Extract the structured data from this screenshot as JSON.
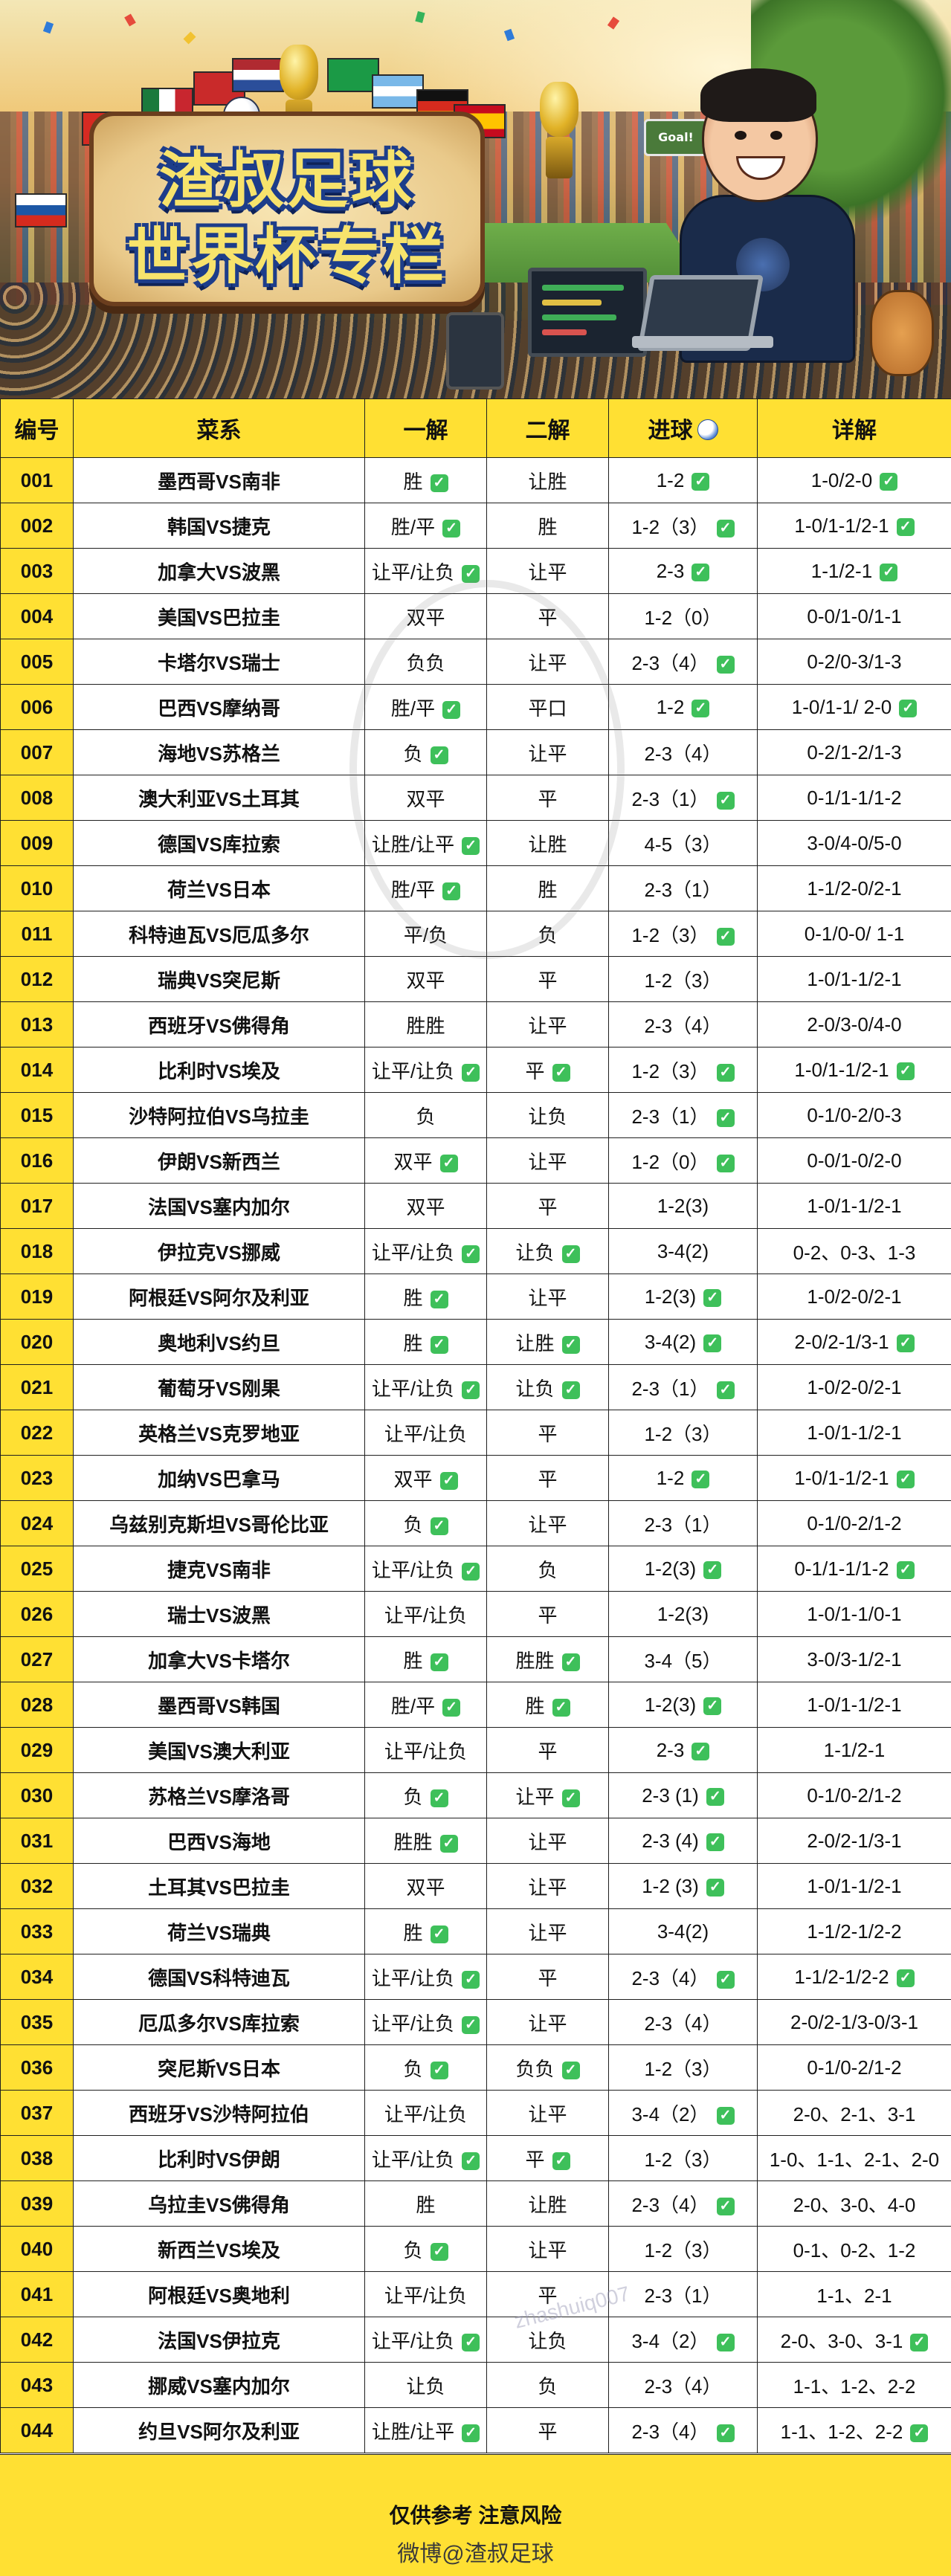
{
  "hero": {
    "title_line1": "渣叔足球",
    "title_line2": "世界杯专栏",
    "goal_sign": "Goal!"
  },
  "table": {
    "headers": [
      "编号",
      "菜系",
      "一解",
      "二解",
      "进球",
      "详解"
    ],
    "rows": [
      {
        "id": "001",
        "match": "墨西哥VS南非",
        "p1": "胜",
        "p1_ok": true,
        "p2": "让胜",
        "p2_ok": false,
        "goals": "1-2",
        "goals_ok": true,
        "detail": "1-0/2-0",
        "detail_ok": true
      },
      {
        "id": "002",
        "match": "韩国VS捷克",
        "p1": "胜/平",
        "p1_ok": true,
        "p2": "胜",
        "p2_ok": false,
        "goals": "1-2（3）",
        "goals_ok": true,
        "detail": "1-0/1-1/2-1",
        "detail_ok": true
      },
      {
        "id": "003",
        "match": "加拿大VS波黑",
        "p1": "让平/让负",
        "p1_ok": true,
        "p2": "让平",
        "p2_ok": false,
        "goals": "2-3",
        "goals_ok": true,
        "detail": "1-1/2-1",
        "detail_ok": true
      },
      {
        "id": "004",
        "match": "美国VS巴拉圭",
        "p1": "双平",
        "p1_ok": false,
        "p2": "平",
        "p2_ok": false,
        "goals": "1-2（0）",
        "goals_ok": false,
        "detail": "0-0/1-0/1-1",
        "detail_ok": false
      },
      {
        "id": "005",
        "match": "卡塔尔VS瑞士",
        "p1": "负负",
        "p1_ok": false,
        "p2": "让平",
        "p2_ok": false,
        "goals": "2-3（4）",
        "goals_ok": true,
        "detail": "0-2/0-3/1-3",
        "detail_ok": false
      },
      {
        "id": "006",
        "match": "巴西VS摩纳哥",
        "p1": "胜/平",
        "p1_ok": true,
        "p2": "平口",
        "p2_ok": false,
        "goals": "1-2",
        "goals_ok": true,
        "detail": "1-0/1-1/ 2-0",
        "detail_ok": true
      },
      {
        "id": "007",
        "match": "海地VS苏格兰",
        "p1": "负",
        "p1_ok": true,
        "p2": "让平",
        "p2_ok": false,
        "goals": "2-3（4）",
        "goals_ok": false,
        "detail": "0-2/1-2/1-3",
        "detail_ok": false
      },
      {
        "id": "008",
        "match": "澳大利亚VS土耳其",
        "p1": "双平",
        "p1_ok": false,
        "p2": "平",
        "p2_ok": false,
        "goals": "2-3（1）",
        "goals_ok": true,
        "detail": "0-1/1-1/1-2",
        "detail_ok": false
      },
      {
        "id": "009",
        "match": "德国VS库拉索",
        "p1": "让胜/让平",
        "p1_ok": true,
        "p2": "让胜",
        "p2_ok": false,
        "goals": "4-5（3）",
        "goals_ok": false,
        "detail": "3-0/4-0/5-0",
        "detail_ok": false
      },
      {
        "id": "010",
        "match": "荷兰VS日本",
        "p1": "胜/平",
        "p1_ok": true,
        "p2": "胜",
        "p2_ok": false,
        "goals": "2-3（1）",
        "goals_ok": false,
        "detail": "1-1/2-0/2-1",
        "detail_ok": false
      },
      {
        "id": "011",
        "match": "科特迪瓦VS厄瓜多尔",
        "p1": "平/负",
        "p1_ok": false,
        "p2": "负",
        "p2_ok": false,
        "goals": "1-2（3）",
        "goals_ok": true,
        "detail": "0-1/0-0/ 1-1",
        "detail_ok": false
      },
      {
        "id": "012",
        "match": "瑞典VS突尼斯",
        "p1": "双平",
        "p1_ok": false,
        "p2": "平",
        "p2_ok": false,
        "goals": "1-2（3）",
        "goals_ok": false,
        "detail": "1-0/1-1/2-1",
        "detail_ok": false
      },
      {
        "id": "013",
        "match": "西班牙VS佛得角",
        "p1": "胜胜",
        "p1_ok": false,
        "p2": "让平",
        "p2_ok": false,
        "goals": "2-3（4）",
        "goals_ok": false,
        "detail": "2-0/3-0/4-0",
        "detail_ok": false
      },
      {
        "id": "014",
        "match": "比利时VS埃及",
        "p1": "让平/让负",
        "p1_ok": true,
        "p2": "平",
        "p2_ok": true,
        "goals": "1-2（3）",
        "goals_ok": true,
        "detail": "1-0/1-1/2-1",
        "detail_ok": true
      },
      {
        "id": "015",
        "match": "沙特阿拉伯VS乌拉圭",
        "p1": "负",
        "p1_ok": false,
        "p2": "让负",
        "p2_ok": false,
        "goals": "2-3（1）",
        "goals_ok": true,
        "detail": "0-1/0-2/0-3",
        "detail_ok": false
      },
      {
        "id": "016",
        "match": "伊朗VS新西兰",
        "p1": "双平",
        "p1_ok": true,
        "p2": "让平",
        "p2_ok": false,
        "goals": "1-2（0）",
        "goals_ok": true,
        "detail": "0-0/1-0/2-0",
        "detail_ok": false
      },
      {
        "id": "017",
        "match": "法国VS塞内加尔",
        "p1": "双平",
        "p1_ok": false,
        "p2": "平",
        "p2_ok": false,
        "goals": "1-2(3)",
        "goals_ok": false,
        "detail": "1-0/1-1/2-1",
        "detail_ok": false
      },
      {
        "id": "018",
        "match": "伊拉克VS挪威",
        "p1": "让平/让负",
        "p1_ok": true,
        "p2": "让负",
        "p2_ok": true,
        "goals": "3-4(2)",
        "goals_ok": false,
        "detail": "0-2、0-3、1-3",
        "detail_ok": false
      },
      {
        "id": "019",
        "match": "阿根廷VS阿尔及利亚",
        "p1": "胜",
        "p1_ok": true,
        "p2": "让平",
        "p2_ok": false,
        "goals": "1-2(3)",
        "goals_ok": true,
        "detail": "1-0/2-0/2-1",
        "detail_ok": false
      },
      {
        "id": "020",
        "match": "奥地利VS约旦",
        "p1": "胜",
        "p1_ok": true,
        "p2": "让胜",
        "p2_ok": true,
        "goals": "3-4(2)",
        "goals_ok": true,
        "detail": "2-0/2-1/3-1",
        "detail_ok": true
      },
      {
        "id": "021",
        "match": "葡萄牙VS刚果",
        "p1": "让平/让负",
        "p1_ok": true,
        "p2": "让负",
        "p2_ok": true,
        "goals": "2-3（1）",
        "goals_ok": true,
        "detail": "1-0/2-0/2-1",
        "detail_ok": false
      },
      {
        "id": "022",
        "match": "英格兰VS克罗地亚",
        "p1": "让平/让负",
        "p1_ok": false,
        "p2": "平",
        "p2_ok": false,
        "goals": "1-2（3）",
        "goals_ok": false,
        "detail": "1-0/1-1/2-1",
        "detail_ok": false
      },
      {
        "id": "023",
        "match": "加纳VS巴拿马",
        "p1": "双平",
        "p1_ok": true,
        "p2": "平",
        "p2_ok": false,
        "goals": "1-2",
        "goals_ok": true,
        "detail": "1-0/1-1/2-1",
        "detail_ok": true
      },
      {
        "id": "024",
        "match": "乌兹别克斯坦VS哥伦比亚",
        "p1": "负",
        "p1_ok": true,
        "p2": "让平",
        "p2_ok": false,
        "goals": "2-3（1）",
        "goals_ok": false,
        "detail": "0-1/0-2/1-2",
        "detail_ok": false
      },
      {
        "id": "025",
        "match": "捷克VS南非",
        "p1": "让平/让负",
        "p1_ok": true,
        "p2": "负",
        "p2_ok": false,
        "goals": "1-2(3)",
        "goals_ok": true,
        "detail": "0-1/1-1/1-2",
        "detail_ok": true
      },
      {
        "id": "026",
        "match": "瑞士VS波黑",
        "p1": "让平/让负",
        "p1_ok": false,
        "p2": "平",
        "p2_ok": false,
        "goals": "1-2(3)",
        "goals_ok": false,
        "detail": "1-0/1-1/0-1",
        "detail_ok": false
      },
      {
        "id": "027",
        "match": "加拿大VS卡塔尔",
        "p1": "胜",
        "p1_ok": true,
        "p2": "胜胜",
        "p2_ok": true,
        "goals": "3-4（5）",
        "goals_ok": false,
        "detail": "3-0/3-1/2-1",
        "detail_ok": false
      },
      {
        "id": "028",
        "match": "墨西哥VS韩国",
        "p1": "胜/平",
        "p1_ok": true,
        "p2": "胜",
        "p2_ok": true,
        "goals": "1-2(3)",
        "goals_ok": true,
        "detail": "1-0/1-1/2-1",
        "detail_ok": false
      },
      {
        "id": "029",
        "match": "美国VS澳大利亚",
        "p1": "让平/让负",
        "p1_ok": false,
        "p2": "平",
        "p2_ok": false,
        "goals": "2-3",
        "goals_ok": true,
        "detail": "1-1/2-1",
        "detail_ok": false
      },
      {
        "id": "030",
        "match": "苏格兰VS摩洛哥",
        "p1": "负",
        "p1_ok": true,
        "p2": "让平",
        "p2_ok": true,
        "goals": "2-3 (1)",
        "goals_ok": true,
        "detail": "0-1/0-2/1-2",
        "detail_ok": false
      },
      {
        "id": "031",
        "match": "巴西VS海地",
        "p1": "胜胜",
        "p1_ok": true,
        "p2": "让平",
        "p2_ok": false,
        "goals": "2-3 (4)",
        "goals_ok": true,
        "detail": "2-0/2-1/3-1",
        "detail_ok": false
      },
      {
        "id": "032",
        "match": "土耳其VS巴拉圭",
        "p1": "双平",
        "p1_ok": false,
        "p2": "让平",
        "p2_ok": false,
        "goals": "1-2 (3)",
        "goals_ok": true,
        "detail": "1-0/1-1/2-1",
        "detail_ok": false
      },
      {
        "id": "033",
        "match": "荷兰VS瑞典",
        "p1": "胜",
        "p1_ok": true,
        "p2": "让平",
        "p2_ok": false,
        "goals": "3-4(2)",
        "goals_ok": false,
        "detail": "1-1/2-1/2-2",
        "detail_ok": false
      },
      {
        "id": "034",
        "match": "德国VS科特迪瓦",
        "p1": "让平/让负",
        "p1_ok": true,
        "p2": "平",
        "p2_ok": false,
        "goals": "2-3（4）",
        "goals_ok": true,
        "detail": "1-1/2-1/2-2",
        "detail_ok": true
      },
      {
        "id": "035",
        "match": "厄瓜多尔VS库拉索",
        "p1": "让平/让负",
        "p1_ok": true,
        "p2": "让平",
        "p2_ok": false,
        "goals": "2-3（4）",
        "goals_ok": false,
        "detail": "2-0/2-1/3-0/3-1",
        "detail_ok": false
      },
      {
        "id": "036",
        "match": "突尼斯VS日本",
        "p1": "负",
        "p1_ok": true,
        "p2": "负负",
        "p2_ok": true,
        "goals": "1-2（3）",
        "goals_ok": false,
        "detail": "0-1/0-2/1-2",
        "detail_ok": false
      },
      {
        "id": "037",
        "match": "西班牙VS沙特阿拉伯",
        "p1": "让平/让负",
        "p1_ok": false,
        "p2": "让平",
        "p2_ok": false,
        "goals": "3-4（2）",
        "goals_ok": true,
        "detail": "2-0、2-1、3-1",
        "detail_ok": false
      },
      {
        "id": "038",
        "match": "比利时VS伊朗",
        "p1": "让平/让负",
        "p1_ok": true,
        "p2": "平",
        "p2_ok": true,
        "goals": "1-2（3）",
        "goals_ok": false,
        "detail": "1-0、1-1、2-1、2-0",
        "detail_ok": false
      },
      {
        "id": "039",
        "match": "乌拉圭VS佛得角",
        "p1": "胜",
        "p1_ok": false,
        "p2": "让胜",
        "p2_ok": false,
        "goals": "2-3（4）",
        "goals_ok": true,
        "detail": "2-0、3-0、4-0",
        "detail_ok": false
      },
      {
        "id": "040",
        "match": "新西兰VS埃及",
        "p1": "负",
        "p1_ok": true,
        "p2": "让平",
        "p2_ok": false,
        "goals": "1-2（3）",
        "goals_ok": false,
        "detail": "0-1、0-2、1-2",
        "detail_ok": false
      },
      {
        "id": "041",
        "match": "阿根廷VS奥地利",
        "p1": "让平/让负",
        "p1_ok": false,
        "p2": "平",
        "p2_ok": false,
        "goals": "2-3（1）",
        "goals_ok": false,
        "detail": "1-1、2-1",
        "detail_ok": false
      },
      {
        "id": "042",
        "match": "法国VS伊拉克",
        "p1": "让平/让负",
        "p1_ok": true,
        "p2": "让负",
        "p2_ok": false,
        "goals": "3-4（2）",
        "goals_ok": true,
        "detail": "2-0、3-0、3-1",
        "detail_ok": true
      },
      {
        "id": "043",
        "match": "挪威VS塞内加尔",
        "p1": "让负",
        "p1_ok": false,
        "p2": "负",
        "p2_ok": false,
        "goals": "2-3（4）",
        "goals_ok": false,
        "detail": "1-1、1-2、2-2",
        "detail_ok": false
      },
      {
        "id": "044",
        "match": "约旦VS阿尔及利亚",
        "p1": "让胜/让平",
        "p1_ok": true,
        "p2": "平",
        "p2_ok": false,
        "goals": "2-3（4）",
        "goals_ok": true,
        "detail": "1-1、1-2、2-2",
        "detail_ok": true
      }
    ]
  },
  "footer": {
    "note": "仅供参考 注意风险",
    "watermark": "微博@渣叔足球"
  },
  "watermark_text": "zhashuiq007",
  "colors": {
    "header_bg": "#ffe033",
    "check_bg": "#3ec05a",
    "title_fill": "#f7e36c",
    "title_outline": "#1d3d8a"
  },
  "icons": {
    "check": "check-icon",
    "goal": "soccer-ball-icon"
  }
}
